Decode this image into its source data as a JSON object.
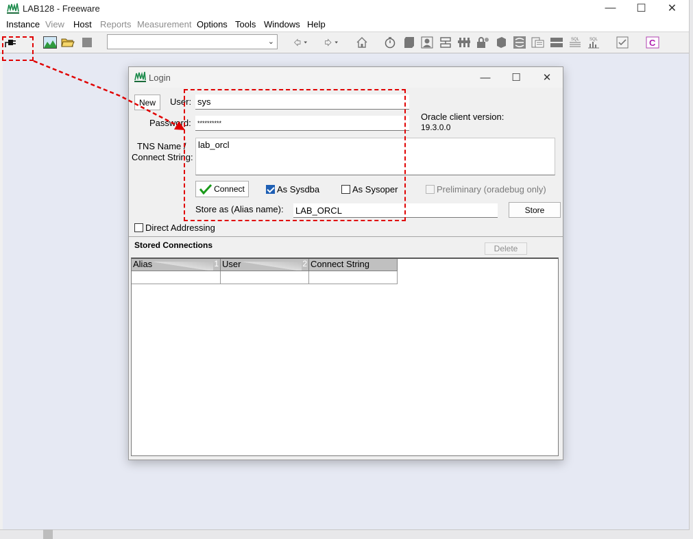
{
  "app": {
    "title": "LAB128 - Freeware",
    "minimize": "—",
    "maximize": "☐",
    "close": "✕"
  },
  "menu": {
    "instance": "Instance",
    "view": "View",
    "host": "Host",
    "reports": "Reports",
    "measurement": "Measurement",
    "options": "Options",
    "tools": "Tools",
    "windows": "Windows",
    "help": "Help"
  },
  "toolbar": {
    "combo_value": "",
    "combo_arrow": "⌄"
  },
  "dialog": {
    "title": "Login",
    "new_button": "New",
    "user_label": "User:",
    "user_value": "sys",
    "password_label": "Password:",
    "password_value": "**********",
    "oracle_version_label": "Oracle client version:",
    "oracle_version_value": "19.3.0.0",
    "tns_label_line1": "TNS Name /",
    "tns_label_line2": "Connect String:",
    "tns_value": "lab_orcl",
    "connect_button": "Connect",
    "as_sysdba": "As Sysdba",
    "as_sysdba_checked": true,
    "as_sysoper": "As Sysoper",
    "as_sysoper_checked": false,
    "preliminary": "Preliminary (oradebug only)",
    "store_as_label": "Store as (Alias name):",
    "store_as_value": "LAB_ORCL",
    "store_button": "Store",
    "direct_addressing": "Direct Addressing",
    "stored_connections_title": "Stored Connections",
    "delete_button": "Delete",
    "grid_columns": [
      {
        "label": "Alias",
        "num": "1"
      },
      {
        "label": "User",
        "num": "2"
      },
      {
        "label": "Connect String",
        "num": ""
      }
    ]
  },
  "colors": {
    "annotation": "#e00000",
    "check_blue": "#1e5fb4"
  }
}
